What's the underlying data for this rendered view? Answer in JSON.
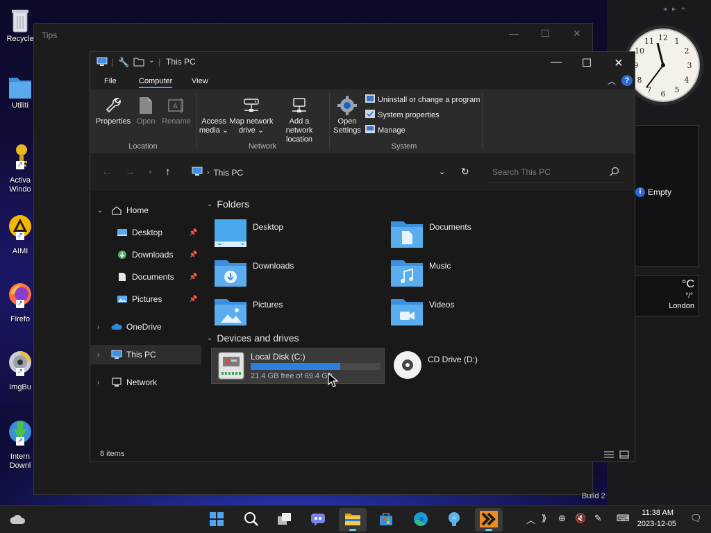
{
  "desktop": {
    "icons": [
      {
        "label": "Recycle"
      },
      {
        "label": "Utiliti"
      },
      {
        "label": "Activa Windo"
      },
      {
        "label": "AIMI"
      },
      {
        "label": "Firefo"
      },
      {
        "label": "ImgBu"
      },
      {
        "label": "Intern Downl"
      }
    ],
    "build_text": "Build 2"
  },
  "tips_window": {
    "title": "Tips"
  },
  "gadgets": {
    "empty_label": "Empty",
    "weather_unit": "°C",
    "weather_sub": "°/°",
    "weather_city": "London"
  },
  "explorer": {
    "title": "This PC",
    "tabs": [
      {
        "label": "File"
      },
      {
        "label": "Computer"
      },
      {
        "label": "View"
      }
    ],
    "ribbon": {
      "location": {
        "label": "Location",
        "properties": "Properties",
        "open": "Open",
        "rename": "Rename"
      },
      "network": {
        "label": "Network",
        "access_media": "Access media ⌄",
        "access_media_1": "Access",
        "access_media_2": "media ⌄",
        "map_drive_1": "Map network",
        "map_drive_2": "drive ⌄",
        "add_location_1": "Add a network",
        "add_location_2": "location"
      },
      "system": {
        "label": "System",
        "open_settings_1": "Open",
        "open_settings_2": "Settings",
        "uninstall": "Uninstall or change a program",
        "system_properties": "System properties",
        "manage": "Manage"
      }
    },
    "address": {
      "path": "This PC",
      "search_placeholder": "Search This PC"
    },
    "nav": {
      "home": "Home",
      "desktop": "Desktop",
      "downloads": "Downloads",
      "documents": "Documents",
      "pictures": "Pictures",
      "onedrive": "OneDrive",
      "this_pc": "This PC",
      "network": "Network"
    },
    "content": {
      "folders_header": "Folders",
      "folders": [
        {
          "name": "Desktop"
        },
        {
          "name": "Documents"
        },
        {
          "name": "Downloads"
        },
        {
          "name": "Music"
        },
        {
          "name": "Pictures"
        },
        {
          "name": "Videos"
        }
      ],
      "drives_header": "Devices and drives",
      "drive_c": {
        "name": "Local Disk (C:)",
        "free": "21.4 GB free of 69.4 GB",
        "used_fraction": 0.69
      },
      "drive_d": {
        "name": "CD Drive (D:)"
      }
    },
    "status": {
      "items": "8 items"
    }
  },
  "taskbar": {
    "time": "11:38 AM",
    "date": "2023-12-05"
  },
  "colors": {
    "accent": "#2f7ee0",
    "folder_blue": "#4aa8ec",
    "folder_light": "#7cc4f5"
  }
}
